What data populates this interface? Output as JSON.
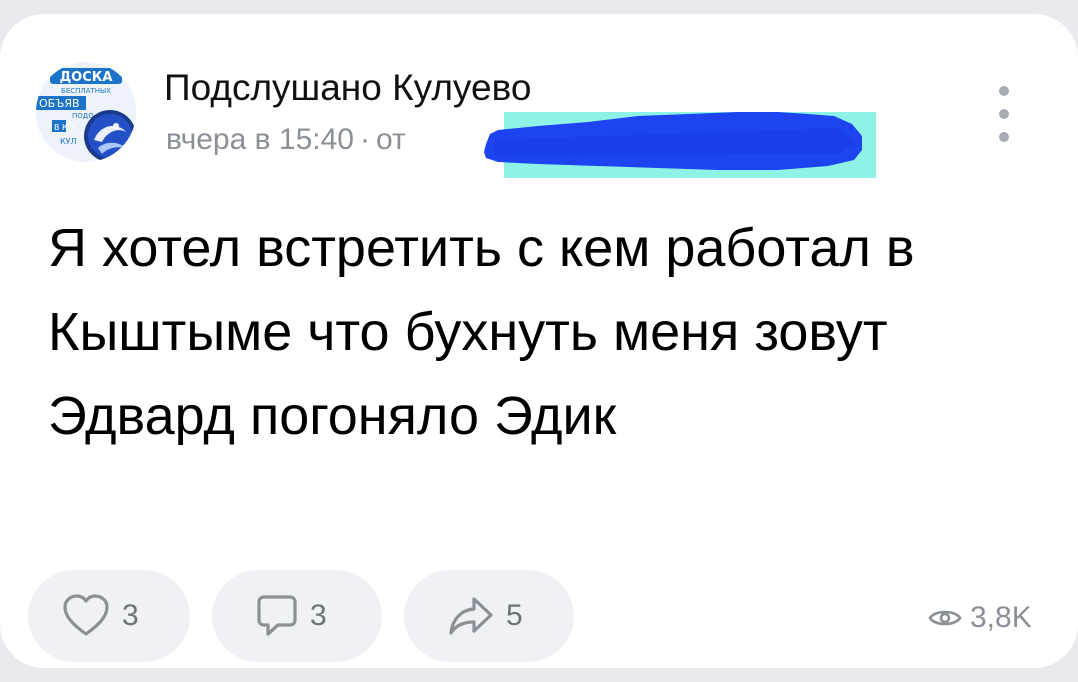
{
  "post": {
    "author": "Подслушано Кулуево",
    "meta_time": "вчера в 15:40",
    "meta_separator": "·",
    "meta_from_prefix": "от",
    "text": "Я хотел встретить с кем работал в Кыштыме что бухнуть меня зовут Эдвард погоняло Эдик"
  },
  "avatar": {
    "lines": [
      "ДОСКА",
      "БЕСПЛАТНЫХ",
      "ОБЪЯВ",
      "ПОДО",
      "В КО",
      "КУЛ"
    ],
    "accent": "#1c74c9"
  },
  "actions": {
    "likes": "3",
    "comments": "3",
    "shares": "5",
    "views": "3,8K"
  },
  "colors": {
    "redaction_highlight": "#8ef2e6",
    "redaction_scribble": "#1d44f0",
    "meta_gray": "#8b8f96"
  },
  "icons": {
    "more": "three-dots-vertical-icon",
    "like": "heart-outline-icon",
    "comment": "speech-bubble-icon",
    "share": "share-arrow-icon",
    "views": "eye-icon"
  }
}
